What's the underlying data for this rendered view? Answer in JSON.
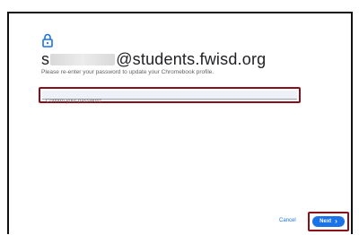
{
  "account": {
    "email_prefix": "s",
    "email_domain": "@students.fwisd.org"
  },
  "prompt": {
    "subtitle": "Please re-enter your password to update your Chromebook profile."
  },
  "password": {
    "placeholder": "Confirm your password",
    "value": ""
  },
  "footer": {
    "cancel_label": "Cancel",
    "next_label": "Next",
    "next_icon": "›"
  },
  "colors": {
    "accent": "#1a73e8",
    "highlight": "#8b0f1a"
  }
}
